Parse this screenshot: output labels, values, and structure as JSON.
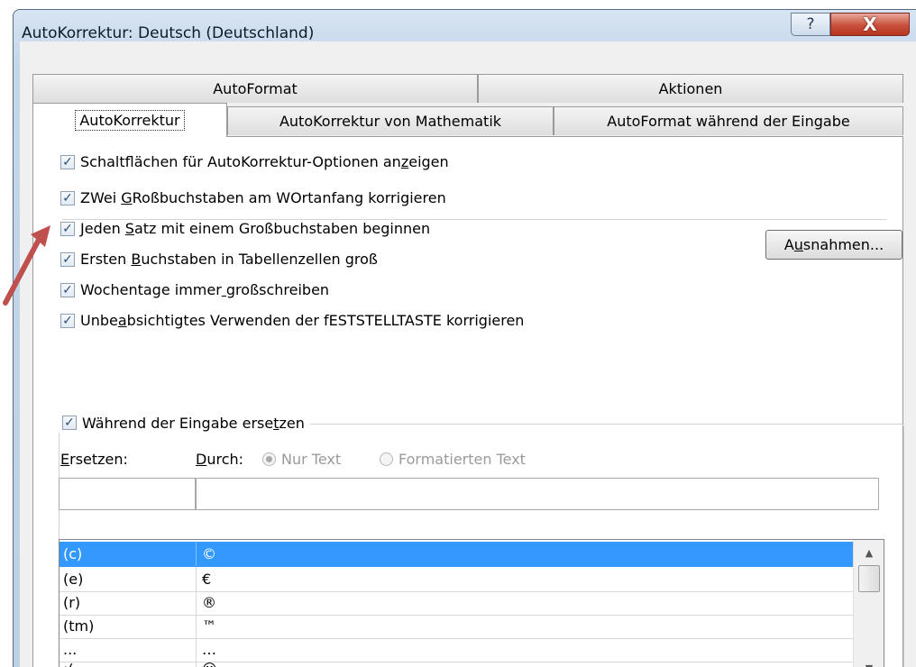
{
  "window": {
    "title": "AutoKorrektur: Deutsch (Deutschland)",
    "help_icon": "?",
    "close_icon": "X"
  },
  "tabs": {
    "back_row": [
      "AutoFormat",
      "Aktionen"
    ],
    "front_row": [
      "AutoKorrektur",
      "AutoKorrektur von Mathematik",
      "AutoFormat während der Eingabe"
    ],
    "active": "AutoKorrektur"
  },
  "options": {
    "show_buttons": {
      "pre": "Schaltflächen für AutoKorrektur-Optionen an",
      "key": "z",
      "post": "eigen",
      "checked": true
    },
    "two_caps": {
      "pre": "ZWei ",
      "key": "G",
      "post": "Roßbuchstaben am WOrtanfang korrigieren",
      "checked": true
    },
    "sentence_caps": {
      "pre": "Jeden ",
      "key": "S",
      "post": "atz mit einem Großbuchstaben beginnen",
      "checked": true
    },
    "table_caps": {
      "pre": "Ersten ",
      "key": "B",
      "post": "uchstaben in Tabellenzellen groß",
      "checked": true
    },
    "weekdays": {
      "pre": "Wochentage immer",
      "key": " ",
      "post": "großschreiben",
      "checked": true
    },
    "caps_lock": {
      "pre": "Unbe",
      "key": "a",
      "post": "bsichtigtes Verwenden der fESTSTELLTASTE korrigieren",
      "checked": true
    }
  },
  "exceptions_button": {
    "pre": "A",
    "key": "u",
    "post": "snahmen..."
  },
  "replace": {
    "group_label_pre": "Während der Eingabe erse",
    "group_label_key": "t",
    "group_label_post": "zen",
    "checked": true,
    "replace_label_key": "E",
    "replace_label_post": "rsetzen:",
    "with_label_key": "D",
    "with_label_post": "urch:",
    "plain_text": "Nur Text",
    "formatted_text": "Formatierten Text",
    "replace_value": "",
    "with_value": ""
  },
  "entries": [
    {
      "from": "(c)",
      "to": "©",
      "selected": true
    },
    {
      "from": "(e)",
      "to": "€",
      "selected": false
    },
    {
      "from": "(r)",
      "to": "®",
      "selected": false
    },
    {
      "from": "(tm)",
      "to": "™",
      "selected": false
    },
    {
      "from": "...",
      "to": "…",
      "selected": false
    },
    {
      "from": ":(",
      "to": "☹",
      "selected": false
    }
  ],
  "colors": {
    "selection": "#3399ff",
    "annotation_arrow": "#c0504d"
  }
}
